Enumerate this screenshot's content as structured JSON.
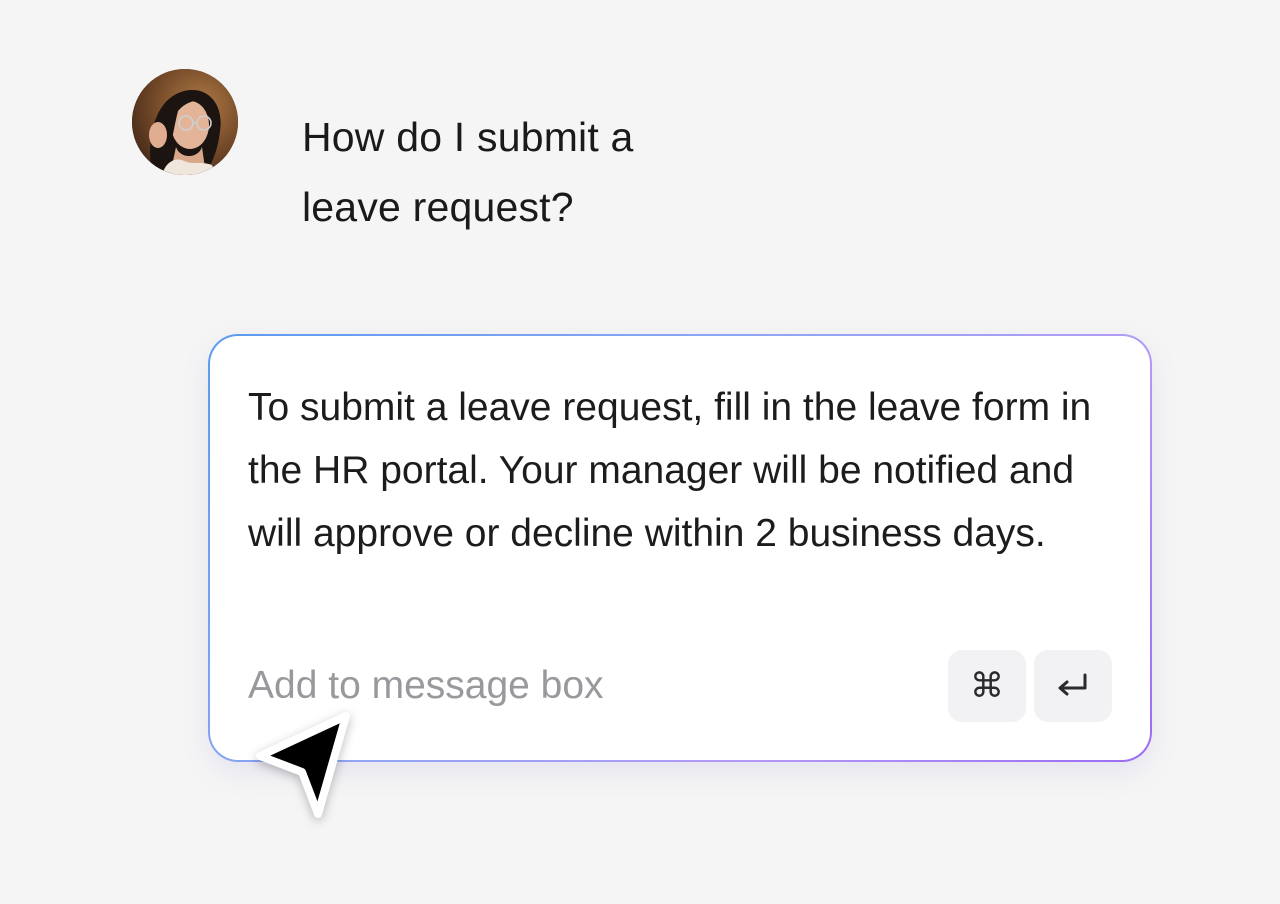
{
  "chat": {
    "user": {
      "avatar_icon": "user-avatar-photo",
      "message": "How do I submit a leave request?"
    },
    "reply": {
      "text": "To submit a leave request, fill in the leave form in the HR portal. Your manager will be notified and will approve or decline within 2 business days."
    },
    "composer": {
      "placeholder": "Add to message box",
      "value": ""
    },
    "shortcut_keys": {
      "command": "⌘",
      "enter": "⏎"
    }
  },
  "colors": {
    "background": "#f5f5f5",
    "card_gradient_start": "#5b9bf0",
    "card_gradient_end": "#9b6cf3",
    "placeholder": "#98989d",
    "key_background": "#f2f2f4"
  }
}
